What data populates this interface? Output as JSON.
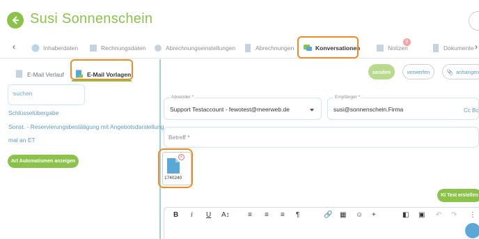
{
  "header": {
    "title": "Susi Sonnenschein"
  },
  "tabs": [
    {
      "label": "Inhaberdaten"
    },
    {
      "label": "Rechnungsdaten"
    },
    {
      "label": "Abrechnungseinstellungen"
    },
    {
      "label": "Abrechnungen"
    },
    {
      "label": "Konversationen"
    },
    {
      "label": "Notizen",
      "badge": "9"
    },
    {
      "label": "Dokumente"
    }
  ],
  "subtabs": [
    {
      "label": "E-Mail Verlauf"
    },
    {
      "label": "E-Mail Vorlagen"
    }
  ],
  "left": {
    "search_placeholder": "suchen",
    "templates": [
      "Schlüsselübergabe",
      "Sonst. - Reservierungsbestätigung mit Angebotsdarstellung",
      "mal an ET"
    ],
    "auto_button": "Art Automatismen anzeigen"
  },
  "actions": {
    "send": "senden",
    "discard": "verwerfen",
    "attach": "anhangen"
  },
  "form": {
    "sender_label": "Absender *",
    "sender_value": "Support Testaccount - fewotest@meerweb.de",
    "recipient_label": "Empfänger *",
    "recipient_value": "susi@sonnenschein.Firma",
    "cc_label": "Cc Bc",
    "subject_label": "Betreff *"
  },
  "attachment": {
    "name": "1740240"
  },
  "ai_button": "KI Text erstellen",
  "colors": {
    "accent": "#8bc34a",
    "highlight": "#f08a24",
    "link": "#5b9bbf"
  }
}
